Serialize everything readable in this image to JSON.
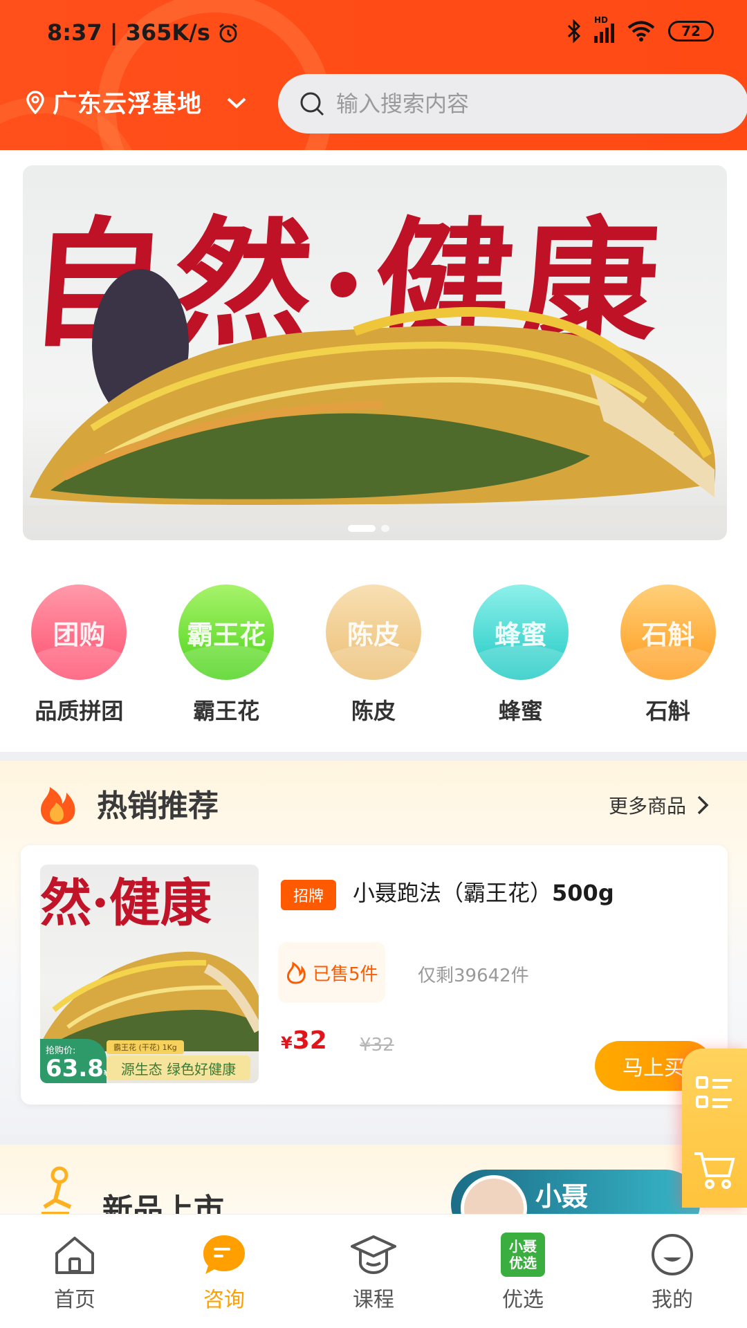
{
  "status": {
    "time_speed": "8:37 | 365K/s",
    "battery": "72",
    "network_label": "HD"
  },
  "header": {
    "location": "广东云浮基地",
    "search_placeholder": "输入搜索内容"
  },
  "banner": {
    "slogan": "自然·健康",
    "slide_count": 2,
    "active_slide": 1
  },
  "categories": [
    {
      "icon_text": "团购",
      "label": "品质拼团",
      "color": "#ff6a86"
    },
    {
      "icon_text": "霸王花",
      "label": "霸王花",
      "color": "#6fe23a"
    },
    {
      "icon_text": "陈皮",
      "label": "陈皮",
      "color": "#f3cc8c"
    },
    {
      "icon_text": "蜂蜜",
      "label": "蜂蜜",
      "color": "#3ed7d2"
    },
    {
      "icon_text": "石斛",
      "label": "石斛",
      "color": "#ffad3a"
    }
  ],
  "hot": {
    "title": "热销推荐",
    "more": "更多商品"
  },
  "product": {
    "image_slogan": "然·健康",
    "tag_label": "抢购价:",
    "tag_price": "63.8",
    "tag_unit": "¥",
    "tag_mini": "霸王花 (干花) 1Kg",
    "tag_banner": "源生态  绿色好健康",
    "badge": "招牌",
    "name_prefix": "小聂跑法（霸王花）",
    "name_bold": "500g",
    "sold": "已售5件",
    "remain_prefix": "仅剩",
    "remain_count": "39642",
    "remain_suffix": "件",
    "currency": "¥",
    "price": "32",
    "old_price": "¥32",
    "buy": "马上买"
  },
  "new_section": {
    "title": "新品上市",
    "coach_name": "小聂"
  },
  "tabs": [
    {
      "label": "首页",
      "icon": "home-icon"
    },
    {
      "label": "咨询",
      "icon": "chat-icon"
    },
    {
      "label": "课程",
      "icon": "graduation-cap-icon"
    },
    {
      "label": "优选",
      "icon": "youxuan-badge",
      "badge_line1": "小聂",
      "badge_line2": "优选"
    },
    {
      "label": "我的",
      "icon": "profile-icon"
    }
  ],
  "active_tab": "咨询",
  "colors": {
    "header": "#ff4a14",
    "accent": "#ffa000",
    "price": "#e0141a",
    "tag_orange": "#ff5a00"
  }
}
